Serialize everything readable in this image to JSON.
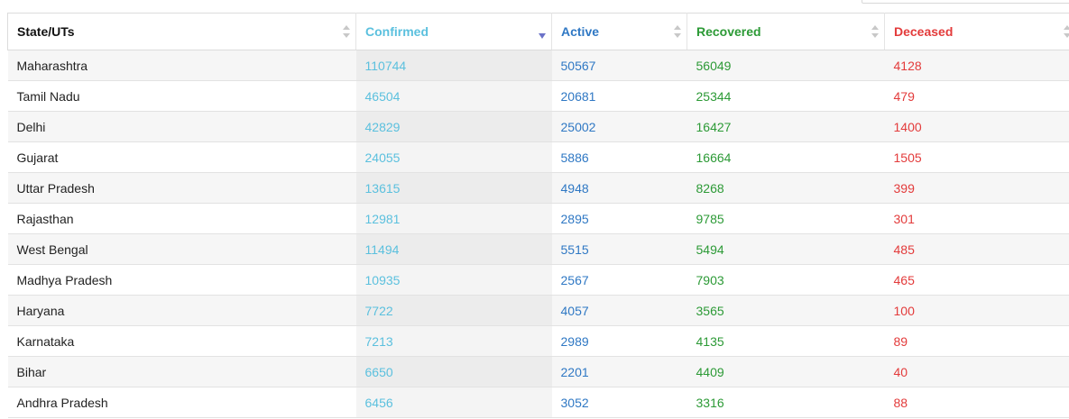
{
  "colors": {
    "confirmed": "#5bc0de",
    "active": "#2f78c4",
    "recovered": "#2c9a36",
    "deceased": "#e33b3b"
  },
  "table": {
    "headers": {
      "state": "State/UTs",
      "confirmed": "Confirmed",
      "active": "Active",
      "recovered": "Recovered",
      "deceased": "Deceased"
    },
    "sorted_by": "confirmed",
    "sort_direction": "descending",
    "rows": [
      {
        "state": "Maharashtra",
        "confirmed": "110744",
        "active": "50567",
        "recovered": "56049",
        "deceased": "4128"
      },
      {
        "state": "Tamil Nadu",
        "confirmed": "46504",
        "active": "20681",
        "recovered": "25344",
        "deceased": "479"
      },
      {
        "state": "Delhi",
        "confirmed": "42829",
        "active": "25002",
        "recovered": "16427",
        "deceased": "1400"
      },
      {
        "state": "Gujarat",
        "confirmed": "24055",
        "active": "5886",
        "recovered": "16664",
        "deceased": "1505"
      },
      {
        "state": "Uttar Pradesh",
        "confirmed": "13615",
        "active": "4948",
        "recovered": "8268",
        "deceased": "399"
      },
      {
        "state": "Rajasthan",
        "confirmed": "12981",
        "active": "2895",
        "recovered": "9785",
        "deceased": "301"
      },
      {
        "state": "West Bengal",
        "confirmed": "11494",
        "active": "5515",
        "recovered": "5494",
        "deceased": "485"
      },
      {
        "state": "Madhya Pradesh",
        "confirmed": "10935",
        "active": "2567",
        "recovered": "7903",
        "deceased": "465"
      },
      {
        "state": "Haryana",
        "confirmed": "7722",
        "active": "4057",
        "recovered": "3565",
        "deceased": "100"
      },
      {
        "state": "Karnataka",
        "confirmed": "7213",
        "active": "2989",
        "recovered": "4135",
        "deceased": "89"
      },
      {
        "state": "Bihar",
        "confirmed": "6650",
        "active": "2201",
        "recovered": "4409",
        "deceased": "40"
      },
      {
        "state": "Andhra Pradesh",
        "confirmed": "6456",
        "active": "3052",
        "recovered": "3316",
        "deceased": "88"
      }
    ]
  }
}
